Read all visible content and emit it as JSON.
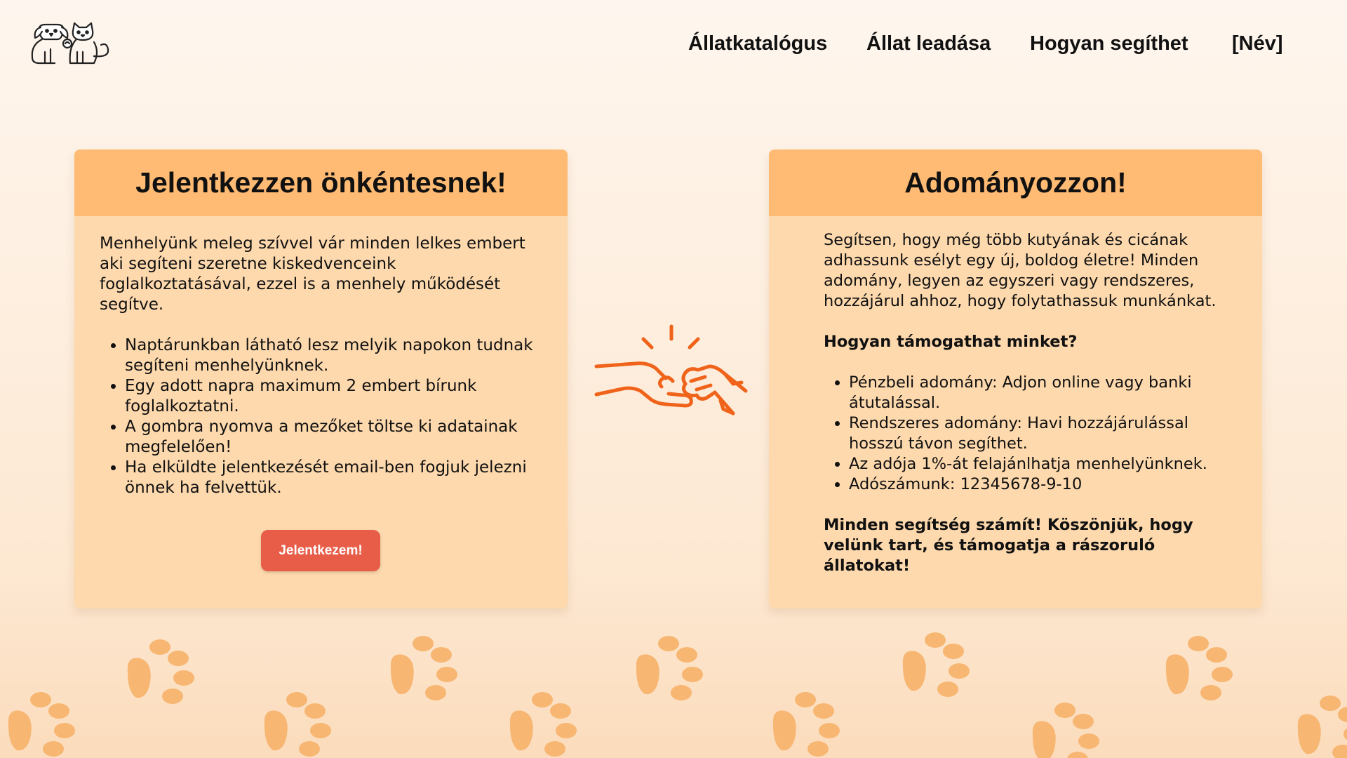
{
  "header": {
    "logo": "dog-and-cat-logo",
    "nav": [
      {
        "label": "Állatkatalógus"
      },
      {
        "label": "Állat leadása"
      },
      {
        "label": "Hogyan segíthet"
      },
      {
        "label": "[Név]"
      }
    ]
  },
  "volunteer_card": {
    "title": "Jelentkezzen önkéntesnek!",
    "intro": "Menhelyünk meleg szívvel vár minden lelkes embert aki segíteni szeretne kiskedvenceink foglalkoztatásával, ezzel is a menhely működését segítve.",
    "items": [
      "Naptárunkban látható lesz melyik napokon tudnak segíteni menhelyünknek.",
      "Egy adott napra maximum 2 embert bírunk foglalkoztatni.",
      "A gombra nyomva a mezőket töltse ki adatainak megfelelően!",
      "Ha elküldte jelentkezését email-ben fogjuk jelezni önnek ha felvettük."
    ],
    "button_label": "Jelentkezem!"
  },
  "donate_card": {
    "title": "Adományozzon!",
    "intro": "Segítsen, hogy még több kutyának és cicának adhassunk esélyt egy új, boldog életre! Minden adomány, legyen az egyszeri vagy rendszeres, hozzájárul ahhoz, hogy folytathassuk munkánkat.",
    "subheading": "Hogyan támogathat minket?",
    "items": [
      "Pénzbeli adomány: Adjon online vagy banki átutalással.",
      "Rendszeres adomány: Havi hozzájárulással hosszú távon segíthet.",
      "Az adója 1%-át felajánlhatja menhelyünknek.",
      "Adószámunk: 12345678-9-10"
    ],
    "closing": "Minden segítség számít! Köszönjük, hogy velünk tart, és támogatja a rászoruló állatokat!"
  },
  "illustration": "fist-bump-icon",
  "decoration": "paw-print-pattern",
  "colors": {
    "background": "#fef6ee",
    "card": "#fed9ad",
    "card_header": "#ffbb73",
    "button": "#e85d48",
    "accent_orange": "#f0631a",
    "paw": "#f7b672"
  }
}
